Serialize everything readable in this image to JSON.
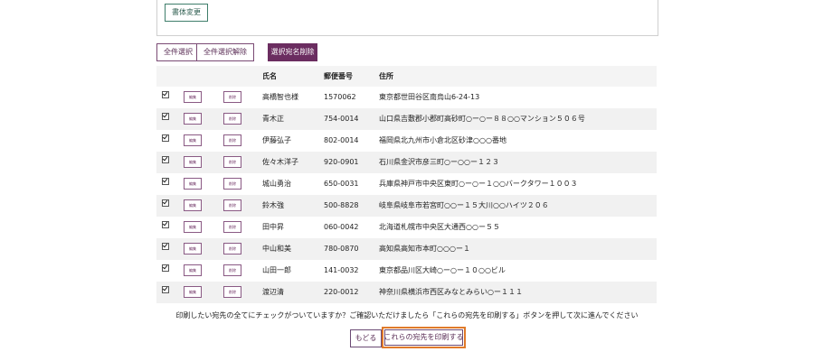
{
  "top_panel": {
    "font_change_label": "書体変更"
  },
  "toolbar": {
    "select_all_label": "全件選択",
    "deselect_all_label": "全件選択解除",
    "delete_selected_label": "選択宛名削除"
  },
  "table": {
    "headers": {
      "name": "氏名",
      "zip": "郵便番号",
      "address": "住所"
    },
    "edit_label": "編集",
    "delete_label": "削除",
    "rows": [
      {
        "name": "高橋智也様",
        "zip": "1570062",
        "address": "東京都世田谷区南烏山6-24-13"
      },
      {
        "name": "青木正",
        "zip": "754-0014",
        "address": "山口県吉敷郡小郡町高砂町○ー○ー８８○○マンション５０６号"
      },
      {
        "name": "伊藤弘子",
        "zip": "802-0014",
        "address": "福岡県北九州市小倉北区砂津○○○番地"
      },
      {
        "name": "佐々木洋子",
        "zip": "920-0901",
        "address": "石川県金沢市彦三町○ー○○ー１２３"
      },
      {
        "name": "城山勇治",
        "zip": "650-0031",
        "address": "兵庫県神戸市中央区東町○ー○ー１○○バークタワー１００３"
      },
      {
        "name": "鈴木強",
        "zip": "500-8828",
        "address": "岐阜県岐阜市若宮町○○ー１５大川○○ハイツ２０６"
      },
      {
        "name": "田中昇",
        "zip": "060-0042",
        "address": "北海道札幌市中央区大通西○○ー５５"
      },
      {
        "name": "中山和美",
        "zip": "780-0870",
        "address": "高知県高知市本町○○○ー１"
      },
      {
        "name": "山田一郎",
        "zip": "141-0032",
        "address": "東京都品川区大崎○ー○ー１０○○ビル"
      },
      {
        "name": "渡辺清",
        "zip": "220-0012",
        "address": "神奈川県横浜市西区みなとみらい○ー１１１"
      }
    ]
  },
  "footer": {
    "notice": "印刷したい宛先の全てにチェックがついていますか？ご確認いただけましたら「これらの宛先を印刷する」ボタンを押して次に進んでください",
    "back_label": "もどる",
    "print_label": "これらの宛先を印刷する"
  }
}
